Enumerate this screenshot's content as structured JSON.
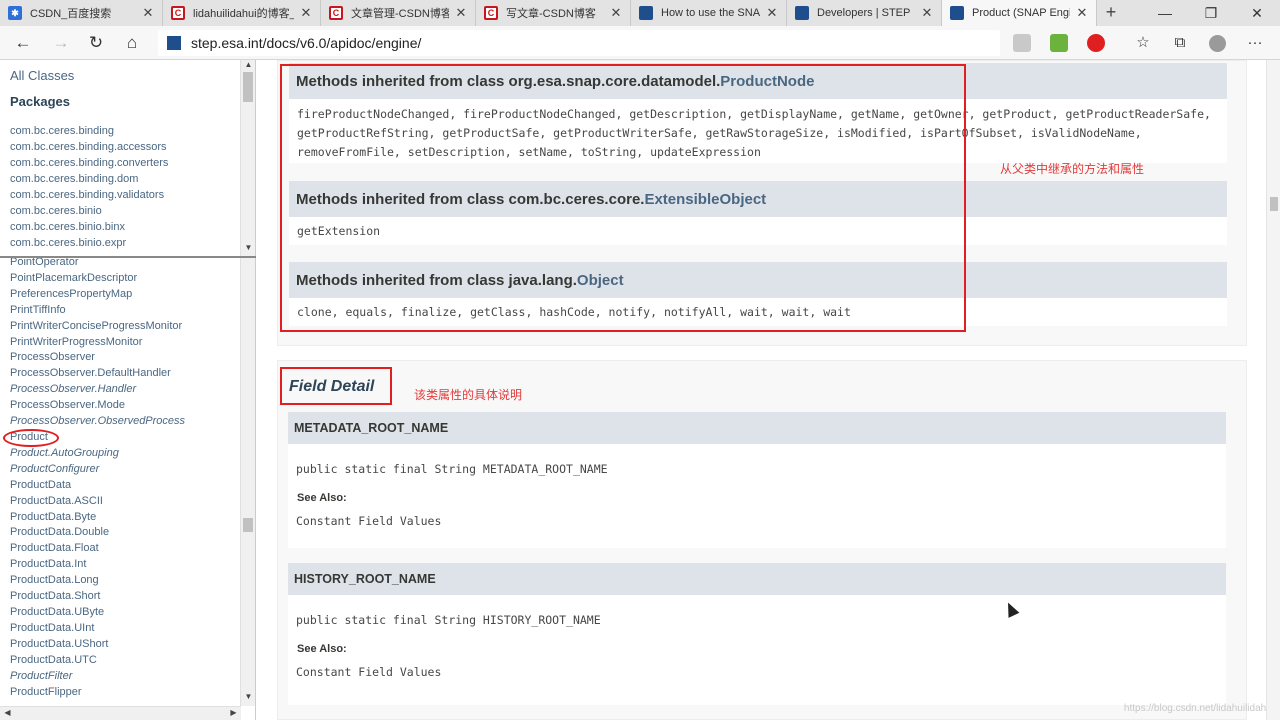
{
  "browser": {
    "tabs": [
      {
        "label": "CSDN_百度搜索",
        "icon": "baidu-icon"
      },
      {
        "label": "lidahuilidahui的博客_lid",
        "icon": "csdn-icon"
      },
      {
        "label": "文章管理-CSDN博客",
        "icon": "csdn-icon"
      },
      {
        "label": "写文章-CSDN博客",
        "icon": "csdn-icon"
      },
      {
        "label": "How to use the SNAP A",
        "icon": "step-icon"
      },
      {
        "label": "Developers | STEP",
        "icon": "step-icon"
      },
      {
        "label": "Product (SNAP Engine",
        "icon": "step-icon"
      }
    ],
    "url": "step.esa.int/docs/v6.0/apidoc/engine/",
    "window_buttons": {
      "minimize": "—",
      "maximize": "❐",
      "close": "✕"
    },
    "newtab": "+",
    "nav": {
      "back": "←",
      "forward": "→",
      "reload": "↻",
      "home": "⌂"
    },
    "tools": {
      "favorites": "☆",
      "collections": "⧉",
      "menu": "···"
    }
  },
  "sidebar": {
    "all_classes": "All Classes",
    "packages_heading": "Packages",
    "packages": [
      "com.bc.ceres.binding",
      "com.bc.ceres.binding.accessors",
      "com.bc.ceres.binding.converters",
      "com.bc.ceres.binding.dom",
      "com.bc.ceres.binding.validators",
      "com.bc.ceres.binio",
      "com.bc.ceres.binio.binx",
      "com.bc.ceres.binio.expr"
    ],
    "classes": [
      {
        "label": "PointOperator",
        "italic": false
      },
      {
        "label": "PointPlacemarkDescriptor",
        "italic": false
      },
      {
        "label": "PreferencesPropertyMap",
        "italic": false
      },
      {
        "label": "PrintTiffInfo",
        "italic": false
      },
      {
        "label": "PrintWriterConciseProgressMonitor",
        "italic": false
      },
      {
        "label": "PrintWriterProgressMonitor",
        "italic": false
      },
      {
        "label": "ProcessObserver",
        "italic": false
      },
      {
        "label": "ProcessObserver.DefaultHandler",
        "italic": false
      },
      {
        "label": "ProcessObserver.Handler",
        "italic": true
      },
      {
        "label": "ProcessObserver.Mode",
        "italic": false
      },
      {
        "label": "ProcessObserver.ObservedProcess",
        "italic": true
      },
      {
        "label": "Product",
        "italic": false
      },
      {
        "label": "Product.AutoGrouping",
        "italic": true
      },
      {
        "label": "ProductConfigurer",
        "italic": true
      },
      {
        "label": "ProductData",
        "italic": false
      },
      {
        "label": "ProductData.ASCII",
        "italic": false
      },
      {
        "label": "ProductData.Byte",
        "italic": false
      },
      {
        "label": "ProductData.Double",
        "italic": false
      },
      {
        "label": "ProductData.Float",
        "italic": false
      },
      {
        "label": "ProductData.Int",
        "italic": false
      },
      {
        "label": "ProductData.Long",
        "italic": false
      },
      {
        "label": "ProductData.Short",
        "italic": false
      },
      {
        "label": "ProductData.UByte",
        "italic": false
      },
      {
        "label": "ProductData.UInt",
        "italic": false
      },
      {
        "label": "ProductData.UShort",
        "italic": false
      },
      {
        "label": "ProductData.UTC",
        "italic": false
      },
      {
        "label": "ProductFilter",
        "italic": true
      },
      {
        "label": "ProductFlipper",
        "italic": false
      }
    ]
  },
  "main": {
    "inherited": [
      {
        "prefix": "Methods inherited from class org.esa.snap.core.datamodel.",
        "link": "ProductNode",
        "lines": [
          "fireProductNodeChanged, fireProductNodeChanged, getDescription, getDisplayName, getName, getOwner, getProduct, getProductReaderSafe,",
          "getProductRefString, getProductSafe, getProductWriterSafe, getRawStorageSize, isModified, isPartOfSubset, isValidNodeName,",
          "removeFromFile, setDescription, setName, toString, updateExpression"
        ]
      },
      {
        "prefix": "Methods inherited from class com.bc.ceres.core.",
        "link": "ExtensibleObject",
        "lines": [
          "getExtension"
        ]
      },
      {
        "prefix": "Methods inherited from class java.lang.",
        "link": "Object",
        "lines": [
          "clone, equals, finalize, getClass, hashCode, notify, notifyAll, wait, wait, wait"
        ]
      }
    ],
    "field_detail_title": "Field Detail",
    "fields": [
      {
        "name": "METADATA_ROOT_NAME",
        "signature": "public static final  String METADATA_ROOT_NAME",
        "see_also": "See Also:",
        "see_also_link": "Constant Field Values"
      },
      {
        "name": "HISTORY_ROOT_NAME",
        "signature": "public static final  String HISTORY_ROOT_NAME",
        "see_also": "See Also:",
        "see_also_link": "Constant Field Values"
      }
    ],
    "annotations": {
      "inherited_note": "从父类中继承的方法和属性",
      "field_note": "该类属性的具体说明"
    },
    "watermark": "https://blog.csdn.net/lidahuilidahui"
  }
}
